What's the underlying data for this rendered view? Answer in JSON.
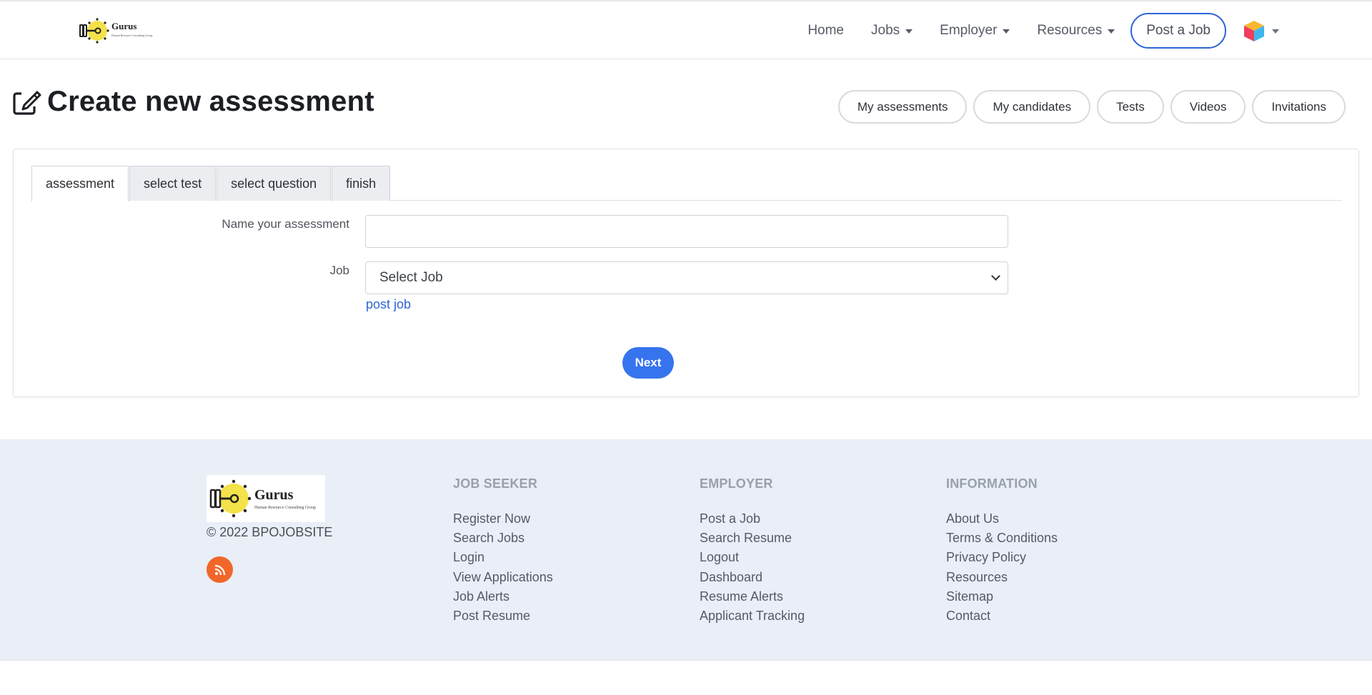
{
  "colors": {
    "accent": "#3674ee",
    "link": "#2e63d8",
    "footer_bg": "#e9eef7",
    "rss": "#f1672a"
  },
  "brand": {
    "name": "Gurus",
    "tagline": "Human Resource Consulting Group"
  },
  "nav": {
    "home": "Home",
    "jobs": "Jobs",
    "employer": "Employer",
    "resources": "Resources",
    "post_job": "Post a Job"
  },
  "header": {
    "title": "Create new assessment",
    "icon": "edit-icon",
    "pills": [
      "My assessments",
      "My candidates",
      "Tests",
      "Videos",
      "Invitations"
    ]
  },
  "tabs": [
    "assessment",
    "select test",
    "select question",
    "finish"
  ],
  "form": {
    "name_label": "Name your assessment",
    "name_value": "",
    "job_label": "Job",
    "job_selected": "Select Job",
    "post_job_link": "post job",
    "next": "Next"
  },
  "footer": {
    "copyright": "© 2022 BPOJOBSITE",
    "columns": [
      {
        "title": "JOB SEEKER",
        "links": [
          "Register Now",
          "Search Jobs",
          "Login",
          "View Applications",
          "Job Alerts",
          "Post Resume"
        ]
      },
      {
        "title": "EMPLOYER",
        "links": [
          "Post a Job",
          "Search Resume",
          "Logout",
          "Dashboard",
          "Resume Alerts",
          "Applicant Tracking"
        ]
      },
      {
        "title": "INFORMATION",
        "links": [
          "About Us",
          "Terms & Conditions",
          "Privacy Policy",
          "Resources",
          "Sitemap",
          "Contact"
        ]
      }
    ]
  }
}
